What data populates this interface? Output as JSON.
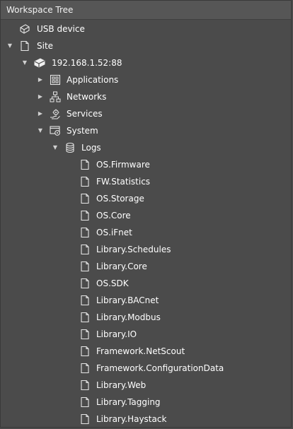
{
  "panel": {
    "title": "Workspace Tree"
  },
  "tree": {
    "usb_device": {
      "label": "USB device",
      "icon": "usb-device-icon"
    },
    "site": {
      "label": "Site",
      "icon": "site-document-icon",
      "expanded": true
    },
    "device": {
      "label": "192.168.1.52:88",
      "icon": "controller-device-icon",
      "expanded": true
    },
    "applications": {
      "label": "Applications",
      "icon": "applications-grid-icon",
      "expanded": false
    },
    "networks": {
      "label": "Networks",
      "icon": "networks-hierarchy-icon",
      "expanded": false
    },
    "services": {
      "label": "Services",
      "icon": "services-gear-icon",
      "expanded": false
    },
    "system": {
      "label": "System",
      "icon": "system-window-gear-icon",
      "expanded": true
    },
    "logs": {
      "label": "Logs",
      "icon": "logs-database-icon",
      "expanded": true
    },
    "log_items": [
      {
        "label": "OS.Firmware"
      },
      {
        "label": "FW.Statistics"
      },
      {
        "label": "OS.Storage"
      },
      {
        "label": "OS.Core"
      },
      {
        "label": "OS.iFnet"
      },
      {
        "label": "Library.Schedules"
      },
      {
        "label": "Library.Core"
      },
      {
        "label": "OS.SDK"
      },
      {
        "label": "Library.BACnet"
      },
      {
        "label": "Library.Modbus"
      },
      {
        "label": "Library.IO"
      },
      {
        "label": "Framework.NetScout"
      },
      {
        "label": "Framework.ConfigurationData"
      },
      {
        "label": "Library.Web"
      },
      {
        "label": "Library.Tagging"
      },
      {
        "label": "Library.Haystack"
      }
    ]
  },
  "colors": {
    "background": "#4b4b4b",
    "header": "#565656",
    "text": "#ffffff",
    "icon_stroke": "#e6e6e6"
  }
}
